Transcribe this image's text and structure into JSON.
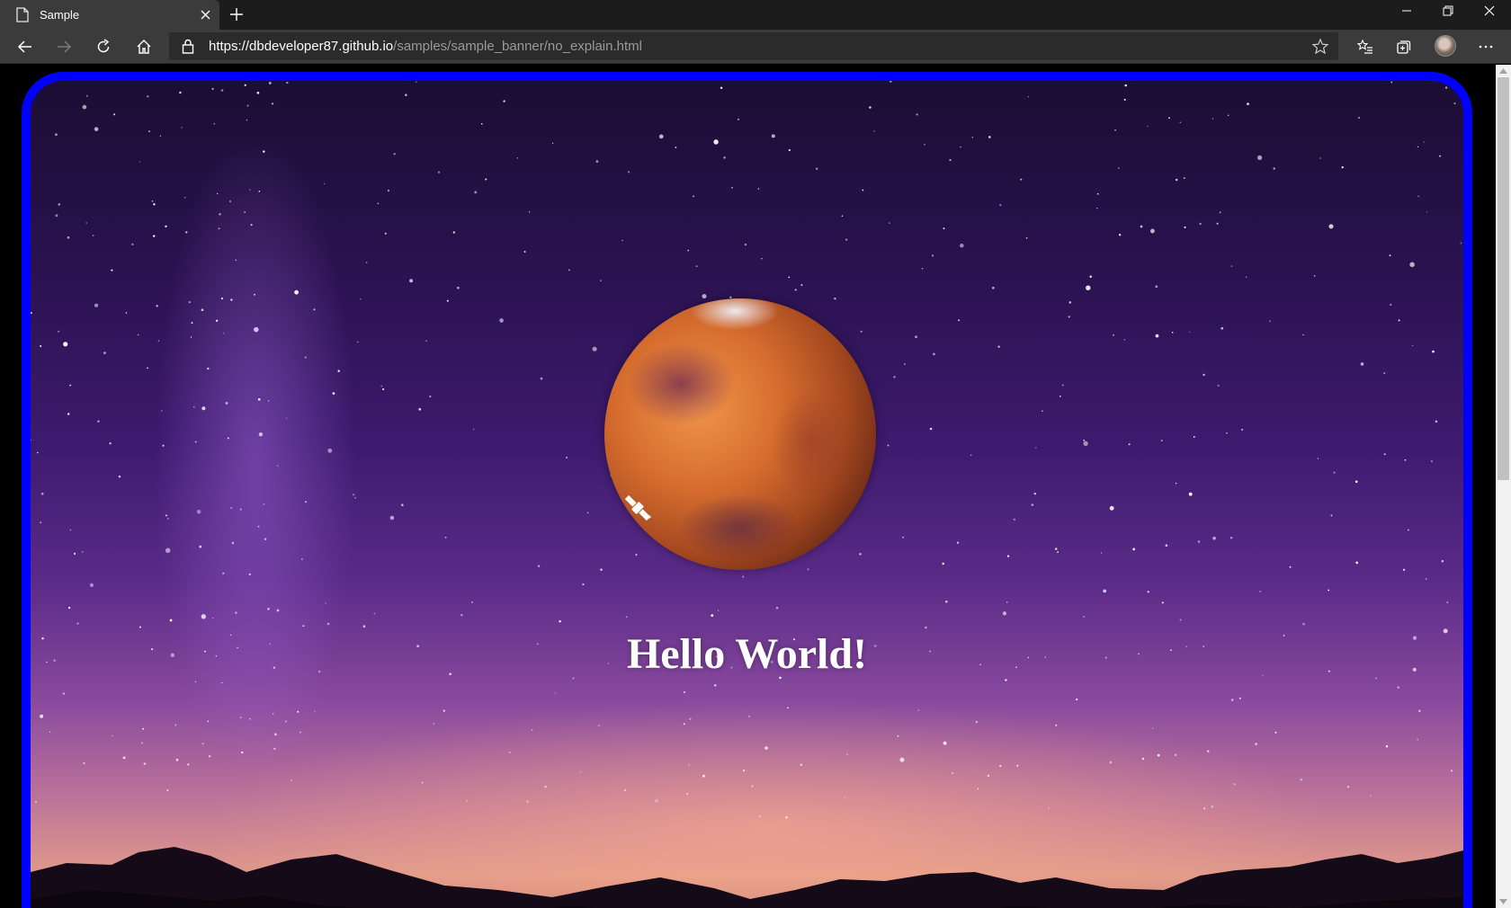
{
  "browser": {
    "tab": {
      "title": "Sample",
      "icon": "page-icon"
    },
    "url": {
      "host_part": "https://dbdeveloper87.github.io",
      "path_part": "/samples/sample_banner/no_explain.html"
    },
    "toolbar_icons": [
      "back-icon",
      "forward-icon",
      "refresh-icon",
      "home-icon",
      "lock-icon",
      "favorite-star-icon",
      "favorites-list-icon",
      "collections-icon",
      "profile-avatar",
      "more-icon"
    ],
    "window_controls": [
      "minimize-icon",
      "restore-icon",
      "close-icon"
    ]
  },
  "page": {
    "headline": "Hello World!",
    "colors": {
      "border": "#0000ff",
      "headline": "#ffffff",
      "sky_top": "#1b0d33",
      "sky_horizon": "#e09a8a"
    }
  }
}
